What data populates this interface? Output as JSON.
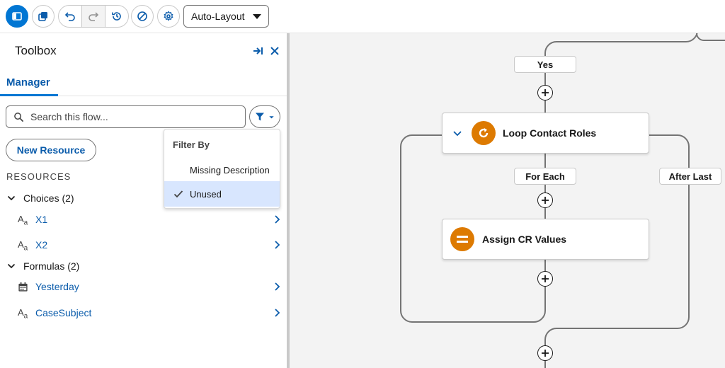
{
  "toolbar": {
    "layout_mode": "Auto-Layout"
  },
  "toolbox": {
    "title": "Toolbox",
    "tab_manager": "Manager",
    "search_placeholder": "Search this flow...",
    "new_resource": "New Resource",
    "resources_header": "RESOURCES",
    "groups": [
      {
        "label": "Choices (2)",
        "items": [
          {
            "label": "X1",
            "icon": "text-type-icon"
          },
          {
            "label": "X2",
            "icon": "text-type-icon"
          }
        ]
      },
      {
        "label": "Formulas (2)",
        "items": [
          {
            "label": "Yesterday",
            "icon": "calendar-icon"
          },
          {
            "label": "CaseSubject",
            "icon": "text-type-icon"
          }
        ]
      }
    ]
  },
  "filter_menu": {
    "heading": "Filter By",
    "options": [
      {
        "label": "Missing Description",
        "selected": false
      },
      {
        "label": "Unused",
        "selected": true
      }
    ]
  },
  "canvas": {
    "branch_yes": "Yes",
    "branch_for_each": "For Each",
    "branch_after_last": "After Last",
    "node_loop": "Loop Contact Roles",
    "node_assign": "Assign CR Values"
  },
  "colors": {
    "accent": "#0176d3",
    "link": "#0b5cab",
    "node_orange": "#dd7a01",
    "selected_bg": "#d8e6fe",
    "canvas_bg": "#f3f3f3"
  }
}
